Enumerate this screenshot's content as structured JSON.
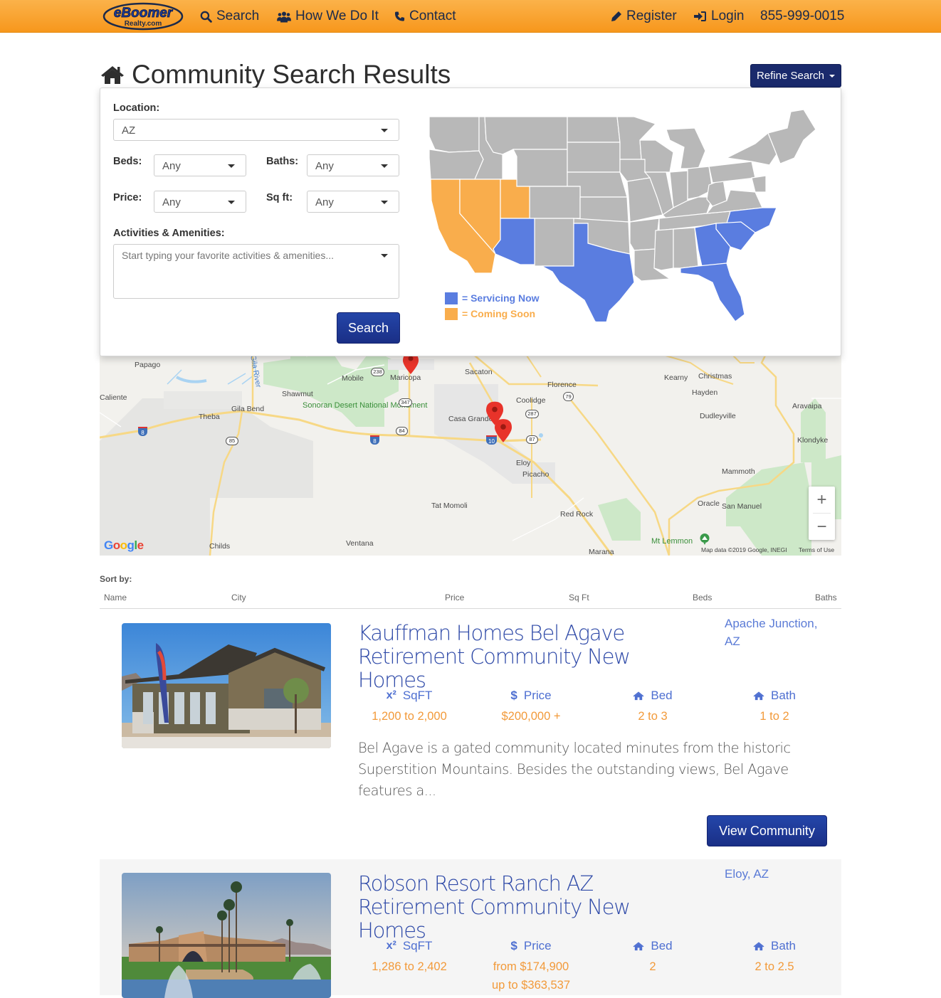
{
  "navbar": {
    "logo_top": "eBoomer",
    "logo_bottom": "Realty.com",
    "items": [
      {
        "label": "Search",
        "icon": "search-icon"
      },
      {
        "label": "How We Do It",
        "icon": "users-icon"
      },
      {
        "label": "Contact",
        "icon": "phone-icon"
      }
    ],
    "right_items": [
      {
        "label": "Register",
        "icon": "pencil-icon"
      },
      {
        "label": "Login",
        "icon": "sign-in-icon"
      }
    ],
    "phone": "855-999-0015"
  },
  "header": {
    "title": "Community Search Results",
    "refine_button": "Refine Search"
  },
  "search_panel": {
    "location_label": "Location:",
    "location_value": "AZ",
    "beds_label": "Beds:",
    "beds_value": "Any",
    "baths_label": "Baths:",
    "baths_value": "Any",
    "price_label": "Price:",
    "price_value": "Any",
    "sqft_label": "Sq ft:",
    "sqft_value": "Any",
    "amenities_label": "Activities & Amenities:",
    "amenities_placeholder": "Start typing your favorite activities & amenities...",
    "search_button": "Search",
    "legend": [
      {
        "label": "= Servicing Now",
        "color": "#5a7de0"
      },
      {
        "label": "= Coming Soon",
        "color": "#f9ad4c"
      }
    ],
    "servicing_states": [
      "AZ",
      "TX",
      "FL",
      "GA",
      "SC",
      "NC"
    ],
    "coming_soon_states": [
      "CA",
      "NV",
      "UT"
    ]
  },
  "map": {
    "labels": [
      "Papago",
      "Caliente",
      "Theba",
      "Gila Bend",
      "Shawmut",
      "Mobile",
      "Maricopa",
      "Sacaton",
      "Florence",
      "Coolidge",
      "Casa Grande",
      "Eloy",
      "Picacho",
      "Tat Momoli",
      "Red Rock",
      "Marana",
      "Kearny",
      "Christmas",
      "Hayden",
      "Dudleyville",
      "Aravaipa",
      "Klondyke",
      "Mammoth",
      "Oracle",
      "San Manuel",
      "Mt Lemmon",
      "Childs",
      "Ventana",
      "Gila River"
    ],
    "monument": "Sonoran Desert National Monument",
    "route_shields": [
      "8",
      "85",
      "238",
      "347",
      "84",
      "8",
      "10",
      "287",
      "87",
      "79"
    ],
    "google": "Google",
    "attribution": "Map data ©2019 Google, INEGI",
    "terms": "Terms of Use",
    "zoom_in": "+",
    "zoom_out": "−"
  },
  "sort": {
    "label": "Sort by:",
    "columns": [
      "Name",
      "City",
      "Price",
      "Sq Ft",
      "Beds",
      "Baths"
    ]
  },
  "listings": [
    {
      "title": "Kauffman Homes Bel Agave Retirement Community New Homes",
      "city": "Apache Junction, AZ",
      "stats": {
        "sqft_label": "SqFT",
        "sqft": "1,200 to 2,000",
        "price_label": "Price",
        "price": "$200,000 +",
        "bed_label": "Bed",
        "bed": "2 to 3",
        "bath_label": "Bath",
        "bath": "1 to 2"
      },
      "description": "Bel Agave is a gated community located minutes from the historic Superstition Mountains. Besides the outstanding views, Bel Agave features a...",
      "button": "View Community"
    },
    {
      "title": "Robson Resort Ranch AZ Retirement Community New Homes",
      "city": "Eloy, AZ",
      "stats": {
        "sqft_label": "SqFT",
        "sqft": "1,286 to 2,402",
        "price_label": "Price",
        "price": "from $174,900",
        "price_2": "up to $363,537",
        "bed_label": "Bed",
        "bed": "2",
        "bath_label": "Bath",
        "bath": "2 to 2.5"
      }
    }
  ]
}
